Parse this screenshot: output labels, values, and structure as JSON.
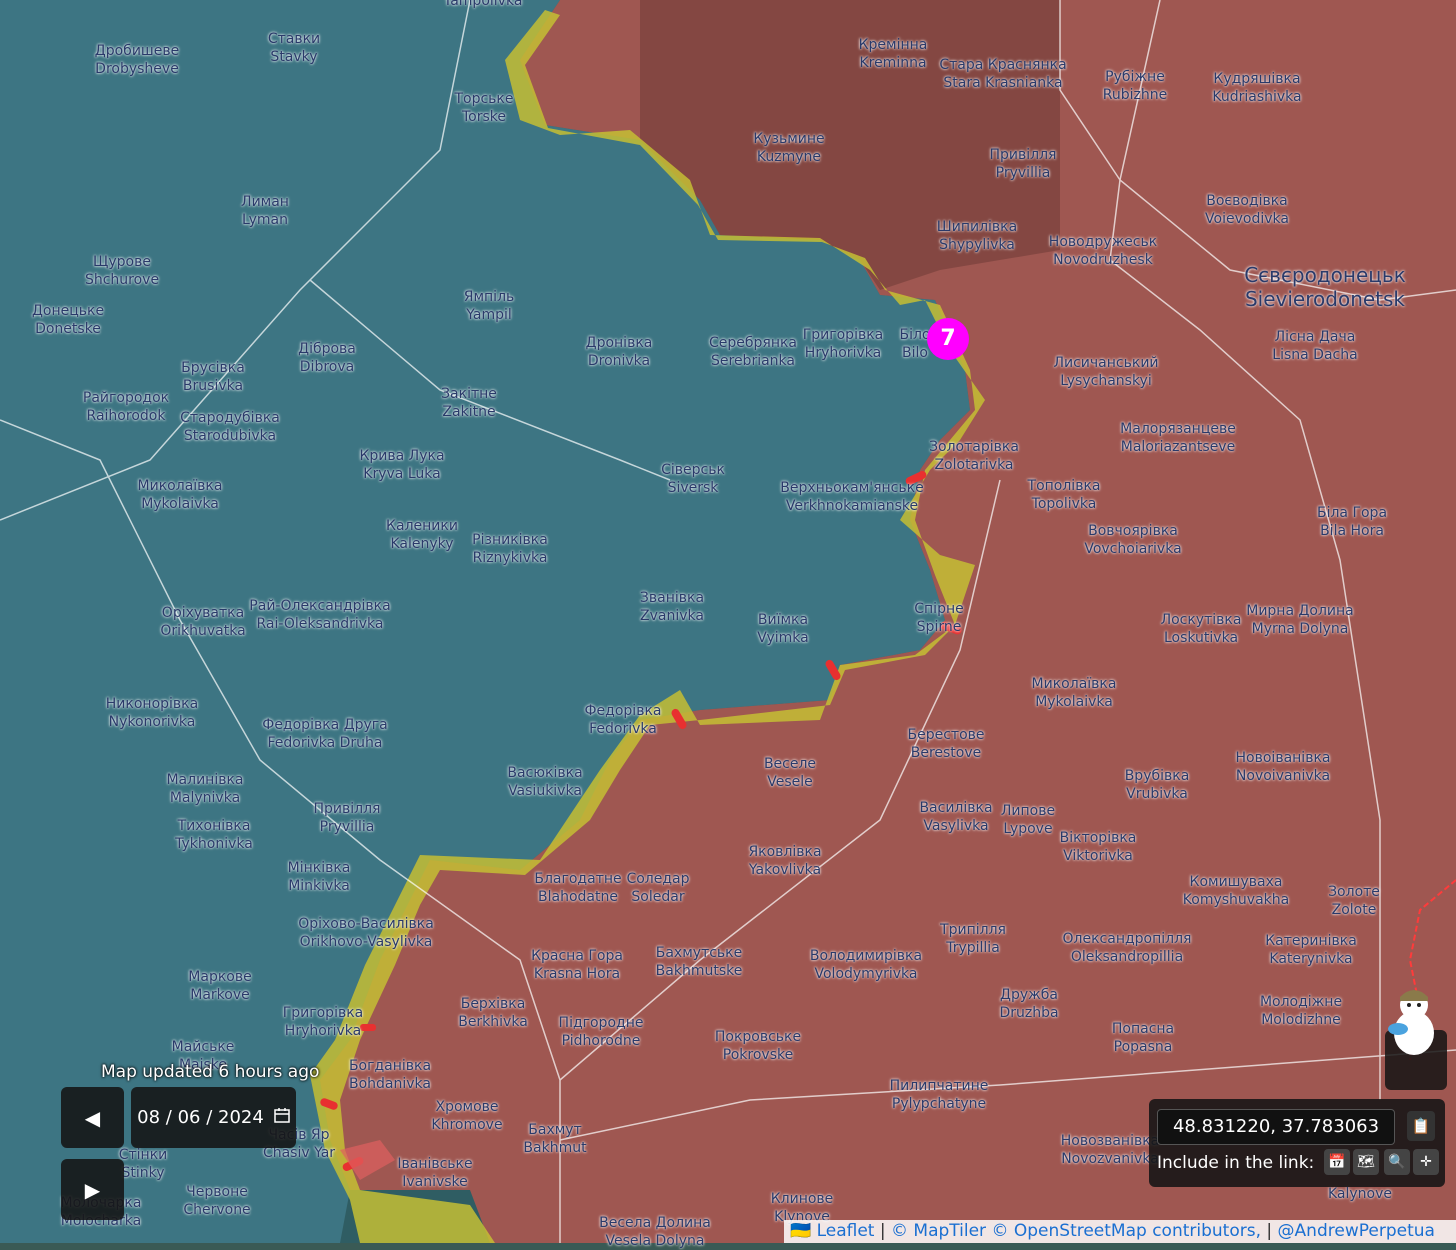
{
  "map": {
    "places": [
      {
        "id": "yampolivka",
        "ua": "",
        "en": "Yampolivka"
      },
      {
        "id": "drobysheve",
        "ua": "Дробишеве",
        "en": "Drobysheve"
      },
      {
        "id": "stavky",
        "ua": "Ставки",
        "en": "Stavky"
      },
      {
        "id": "torske",
        "ua": "Торське",
        "en": "Torske"
      },
      {
        "id": "kreminna",
        "ua": "Кремінна",
        "en": "Kreminna"
      },
      {
        "id": "stara-krasnianka",
        "ua": "Стара Краснянка",
        "en": "Stara Krasnianka"
      },
      {
        "id": "rubizhne",
        "ua": "Рубіжне",
        "en": "Rubizhne"
      },
      {
        "id": "kudriashivka",
        "ua": "Кудряшівка",
        "en": "Kudriashivka"
      },
      {
        "id": "kuzmyne",
        "ua": "Кузьмине",
        "en": "Kuzmyne"
      },
      {
        "id": "pryvillia-n",
        "ua": "Привілля",
        "en": "Pryvillia"
      },
      {
        "id": "voievodivka",
        "ua": "Воєводівка",
        "en": "Voievodivka"
      },
      {
        "id": "lyman",
        "ua": "Лиман",
        "en": "Lyman"
      },
      {
        "id": "shchurove",
        "ua": "Щурове",
        "en": "Shchurove"
      },
      {
        "id": "shypylivka",
        "ua": "Шипилівка",
        "en": "Shypylivka"
      },
      {
        "id": "novodruzhesk",
        "ua": "Новодружеськ",
        "en": "Novodruzhesk"
      },
      {
        "id": "sievierodonetsk",
        "ua": "Сєвєродонецьк",
        "en": "Sievierodonetsk",
        "big": true
      },
      {
        "id": "donetske",
        "ua": "Донецьке",
        "en": "Donetske"
      },
      {
        "id": "yampil",
        "ua": "Ямпіль",
        "en": "Yampil"
      },
      {
        "id": "hryhorivka-n",
        "ua": "Григорівка",
        "en": "Hryhorivka"
      },
      {
        "id": "bilohorivka",
        "ua": "Біло",
        "en": "Bilo"
      },
      {
        "id": "dronivka",
        "ua": "Дронівка",
        "en": "Dronivka"
      },
      {
        "id": "serebrianka",
        "ua": "Серебрянка",
        "en": "Serebrianka"
      },
      {
        "id": "lisna-dacha",
        "ua": "Лісна Дача",
        "en": "Lisna Dacha"
      },
      {
        "id": "dibrova",
        "ua": "Діброва",
        "en": "Dibrova"
      },
      {
        "id": "brusivka",
        "ua": "Брусівка",
        "en": "Brusivka"
      },
      {
        "id": "lysychanskyi",
        "ua": "Лисичанський",
        "en": "Lysychanskyi"
      },
      {
        "id": "raihorodok",
        "ua": "Райгородок",
        "en": "Raihorodok"
      },
      {
        "id": "zakitne",
        "ua": "Закітне",
        "en": "Zakitne"
      },
      {
        "id": "starodubivka",
        "ua": "Стародубівка",
        "en": "Starodubivka"
      },
      {
        "id": "maloriazantseve",
        "ua": "Малорязанцеве",
        "en": "Maloriazantseve"
      },
      {
        "id": "zolotarivka",
        "ua": "Золотарівка",
        "en": "Zolotarivka"
      },
      {
        "id": "kryva-luka",
        "ua": "Крива Лука",
        "en": "Kryva Luka"
      },
      {
        "id": "siversk",
        "ua": "Сіверськ",
        "en": "Siversk"
      },
      {
        "id": "mykolaivka-w",
        "ua": "Миколаївка",
        "en": "Mykolaivka"
      },
      {
        "id": "verkhnokamianske",
        "ua": "Верхньокам'янське",
        "en": "Verkhnokamianske"
      },
      {
        "id": "topolivka",
        "ua": "Тополівка",
        "en": "Topolivka"
      },
      {
        "id": "bila-hora",
        "ua": "Біла Гора",
        "en": "Bila Hora"
      },
      {
        "id": "kalenyky",
        "ua": "Каленики",
        "en": "Kalenyky"
      },
      {
        "id": "riznykivka",
        "ua": "Різниківка",
        "en": "Riznykivka"
      },
      {
        "id": "vovchoiarivka",
        "ua": "Вовчоярівка",
        "en": "Vovchoiarivka"
      },
      {
        "id": "zvanivka",
        "ua": "Званівка",
        "en": "Zvanivka"
      },
      {
        "id": "orikhuvatka",
        "ua": "Оріхуватка",
        "en": "Orikhuvatka"
      },
      {
        "id": "rai-oleksandrivka",
        "ua": "Рай-Олександрівка",
        "en": "Rai-Oleksandrivka"
      },
      {
        "id": "spirne",
        "ua": "Спірне",
        "en": "Spirne"
      },
      {
        "id": "vyimka",
        "ua": "Виїмка",
        "en": "Vyimka"
      },
      {
        "id": "loskutivka",
        "ua": "Лоскутівка",
        "en": "Loskutivka"
      },
      {
        "id": "myrna-dolyna",
        "ua": "Мирна Долина",
        "en": "Myrna Dolyna"
      },
      {
        "id": "mykolaivka-e",
        "ua": "Миколаївка",
        "en": "Mykolaivka"
      },
      {
        "id": "nykonorivka",
        "ua": "Никонорівка",
        "en": "Nykonorivka"
      },
      {
        "id": "fedorivka",
        "ua": "Федорівка",
        "en": "Fedorivka"
      },
      {
        "id": "fedorivka-druha",
        "ua": "Федорівка Друга",
        "en": "Fedorivka Druha"
      },
      {
        "id": "berestove",
        "ua": "Берестове",
        "en": "Berestove"
      },
      {
        "id": "novoivanivka",
        "ua": "Новоіванівка",
        "en": "Novoivanivka"
      },
      {
        "id": "vesele",
        "ua": "Веселе",
        "en": "Vesele"
      },
      {
        "id": "vasiukivka",
        "ua": "Васюківка",
        "en": "Vasiukivka"
      },
      {
        "id": "malynivka",
        "ua": "Малинівка",
        "en": "Malynivka"
      },
      {
        "id": "vrubivka",
        "ua": "Врубівка",
        "en": "Vrubivka"
      },
      {
        "id": "pryvillia-s",
        "ua": "Привілля",
        "en": "Pryvillia"
      },
      {
        "id": "vasylivka",
        "ua": "Василівка",
        "en": "Vasylivka"
      },
      {
        "id": "lypove",
        "ua": "Липове",
        "en": "Lypove"
      },
      {
        "id": "tykhonivka",
        "ua": "Тихонівка",
        "en": "Tykhonivka"
      },
      {
        "id": "viktorivka",
        "ua": "Вікторівка",
        "en": "Viktorivka"
      },
      {
        "id": "yakovlivka",
        "ua": "Яковлівка",
        "en": "Yakovlivka"
      },
      {
        "id": "minkivka",
        "ua": "Мінківка",
        "en": "Minkivka"
      },
      {
        "id": "blahodatne",
        "ua": "Благодатне",
        "en": "Blahodatne"
      },
      {
        "id": "soledar",
        "ua": "Соледар",
        "en": "Soledar"
      },
      {
        "id": "komyshuvakha",
        "ua": "Комишуваха",
        "en": "Komyshuvakha"
      },
      {
        "id": "zolote",
        "ua": "Золоте",
        "en": "Zolote"
      },
      {
        "id": "orikhovo-vasylivka",
        "ua": "Оріхово-Василівка",
        "en": "Orikhovo-Vasylivka"
      },
      {
        "id": "trypillia",
        "ua": "Трипілля",
        "en": "Trypillia"
      },
      {
        "id": "oleksandropillia",
        "ua": "Олександропілля",
        "en": "Oleksandropillia"
      },
      {
        "id": "katerynivka",
        "ua": "Катеринівка",
        "en": "Katerynivka"
      },
      {
        "id": "krasna-hora",
        "ua": "Красна Гора",
        "en": "Krasna Hora"
      },
      {
        "id": "bakhmutske",
        "ua": "Бахмутське",
        "en": "Bakhmutske"
      },
      {
        "id": "volodymyrivka",
        "ua": "Володимирівка",
        "en": "Volodymyrivka"
      },
      {
        "id": "markove",
        "ua": "Маркове",
        "en": "Markove"
      },
      {
        "id": "druzhba",
        "ua": "Дружба",
        "en": "Druzhba"
      },
      {
        "id": "molodizhne",
        "ua": "Молодіжне",
        "en": "Molodizhne"
      },
      {
        "id": "berkhivka",
        "ua": "Берхівка",
        "en": "Berkhivka"
      },
      {
        "id": "hryhorivka-s",
        "ua": "Григорівка",
        "en": "Hryhorivka"
      },
      {
        "id": "popasna",
        "ua": "Попасна",
        "en": "Popasna"
      },
      {
        "id": "pidhorodne",
        "ua": "Підгородне",
        "en": "Pidhorodne"
      },
      {
        "id": "pokrovske",
        "ua": "Покровське",
        "en": "Pokrovske"
      },
      {
        "id": "maiske",
        "ua": "Майське",
        "en": "Maiske"
      },
      {
        "id": "bohdanivka",
        "ua": "Богданівка",
        "en": "Bohdanivka"
      },
      {
        "id": "pylypchatyne",
        "ua": "Пилипчатине",
        "en": "Pylypchatyne"
      },
      {
        "id": "khromove",
        "ua": "Хромове",
        "en": "Khromove"
      },
      {
        "id": "bakhmut",
        "ua": "Бахмут",
        "en": "Bakhmut"
      },
      {
        "id": "chasiv-yar",
        "ua": "Часів Яр",
        "en": "Chasiv Yar"
      },
      {
        "id": "stinky",
        "ua": "Стінки",
        "en": "Stinky"
      },
      {
        "id": "ivanivske",
        "ua": "Іванівське",
        "en": "Ivanivske"
      },
      {
        "id": "novozvanivka",
        "ua": "Новозванівка",
        "en": "Novozvanivka"
      },
      {
        "id": "chervone",
        "ua": "Червоне",
        "en": "Chervone"
      },
      {
        "id": "molocharka",
        "ua": "Молочарка",
        "en": "Molocharka"
      },
      {
        "id": "klynove",
        "ua": "Клинове",
        "en": "Klynove"
      },
      {
        "id": "vesela-dolyna",
        "ua": "Весела Долина",
        "en": "Vesela Dolyna"
      },
      {
        "id": "kalynove",
        "ua": "",
        "en": "Kalynove"
      }
    ],
    "marker_label": "7",
    "colors": {
      "ua_controlled": "#3f7d86",
      "ru_controlled": "#b5645a",
      "contested": "#c8c23a",
      "recent_advance": "#d23b3b",
      "marker": "#ff00ff"
    }
  },
  "controls": {
    "updated_text": "Map updated 6 hours ago",
    "date_value": "08 / 06 / 2024",
    "prev_icon": "◀",
    "next_icon": "▶",
    "calendar_icon": "calendar-icon",
    "coordinates": "48.831220, 37.783063",
    "include_label": "Include in the link:",
    "include_icons": [
      "calendar-icon",
      "map-icon",
      "zoom-icon",
      "crosshair-icon"
    ]
  },
  "attribution": {
    "leaflet": "Leaflet",
    "maptiler": "© MapTiler",
    "osm": "© OpenStreetMap contributors,",
    "author": "@AndrewPerpetua"
  }
}
